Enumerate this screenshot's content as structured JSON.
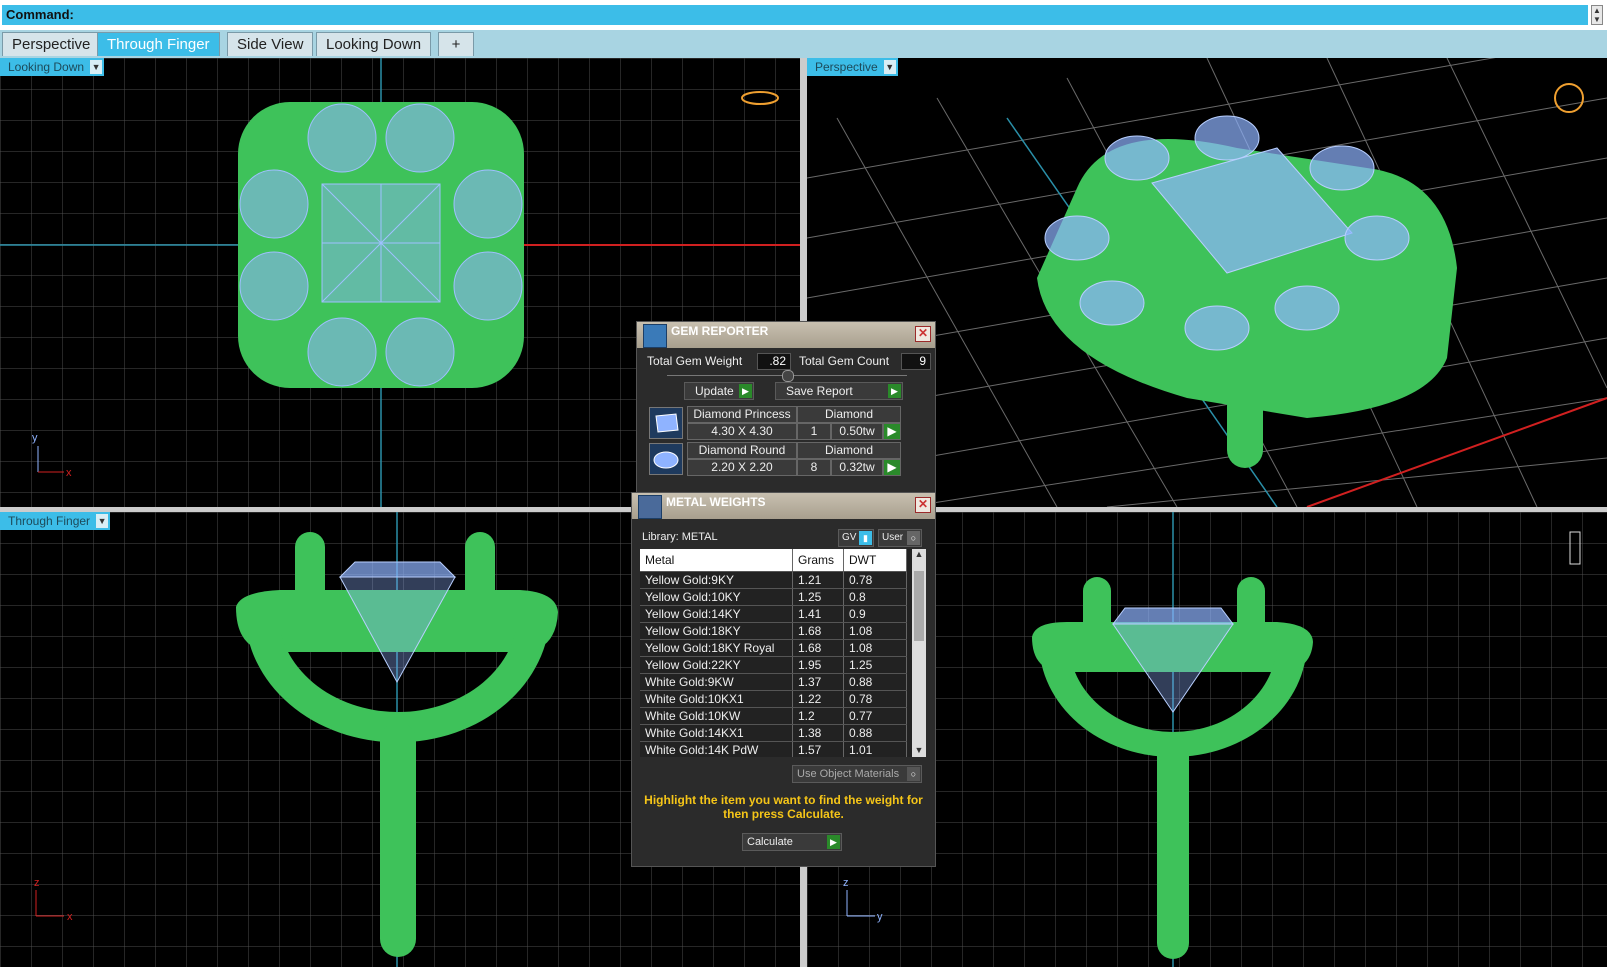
{
  "command": {
    "label": "Command:"
  },
  "tabs": [
    {
      "label": "Perspective"
    },
    {
      "label": "Through Finger"
    },
    {
      "label": "Side View"
    },
    {
      "label": "Looking Down"
    },
    {
      "label": "+"
    }
  ],
  "viewports": {
    "top_left": {
      "label": "Looking Down"
    },
    "top_right": {
      "label": "Perspective"
    },
    "bottom_left": {
      "label": "Through Finger"
    }
  },
  "axes": {
    "x": "x",
    "y": "y",
    "z": "z"
  },
  "gem_reporter": {
    "title": "GEM REPORTER",
    "total_weight_label": "Total Gem Weight",
    "total_weight_value": ".82",
    "total_count_label": "Total Gem Count",
    "total_count_value": "9",
    "update_label": "Update",
    "save_label": "Save Report",
    "gems": [
      {
        "name": "Diamond Princess",
        "size": "4.30 X 4.30",
        "material": "Diamond",
        "count": "1",
        "weight": "0.50tw"
      },
      {
        "name": "Diamond Round",
        "size": "2.20 X 2.20",
        "material": "Diamond",
        "count": "8",
        "weight": "0.32tw"
      }
    ]
  },
  "metal_weights": {
    "title": "METAL WEIGHTS",
    "library_label": "Library: METAL",
    "gv_label": "GV",
    "user_label": "User",
    "columns": [
      "Metal",
      "Grams",
      "DWT"
    ],
    "rows": [
      [
        "Yellow Gold:9KY",
        "1.21",
        "0.78"
      ],
      [
        "Yellow Gold:10KY",
        "1.25",
        "0.8"
      ],
      [
        "Yellow Gold:14KY",
        "1.41",
        "0.9"
      ],
      [
        "Yellow Gold:18KY",
        "1.68",
        "1.08"
      ],
      [
        "Yellow Gold:18KY Royal",
        "1.68",
        "1.08"
      ],
      [
        "Yellow Gold:22KY",
        "1.95",
        "1.25"
      ],
      [
        "White Gold:9KW",
        "1.37",
        "0.88"
      ],
      [
        "White Gold:10KX1",
        "1.22",
        "0.78"
      ],
      [
        "White Gold:10KW",
        "1.2",
        "0.77"
      ],
      [
        "White Gold:14KX1",
        "1.38",
        "0.88"
      ],
      [
        "White Gold:14K PdW",
        "1.57",
        "1.01"
      ]
    ],
    "use_object_materials": "Use Object Materials",
    "hint": "Highlight the item you want to find the weight for then press Calculate.",
    "calculate_label": "Calculate"
  },
  "colors": {
    "accent": "#3cbde8",
    "metal": "#3ec25a",
    "gem": "#8fb3ff",
    "grid": "#555555"
  }
}
